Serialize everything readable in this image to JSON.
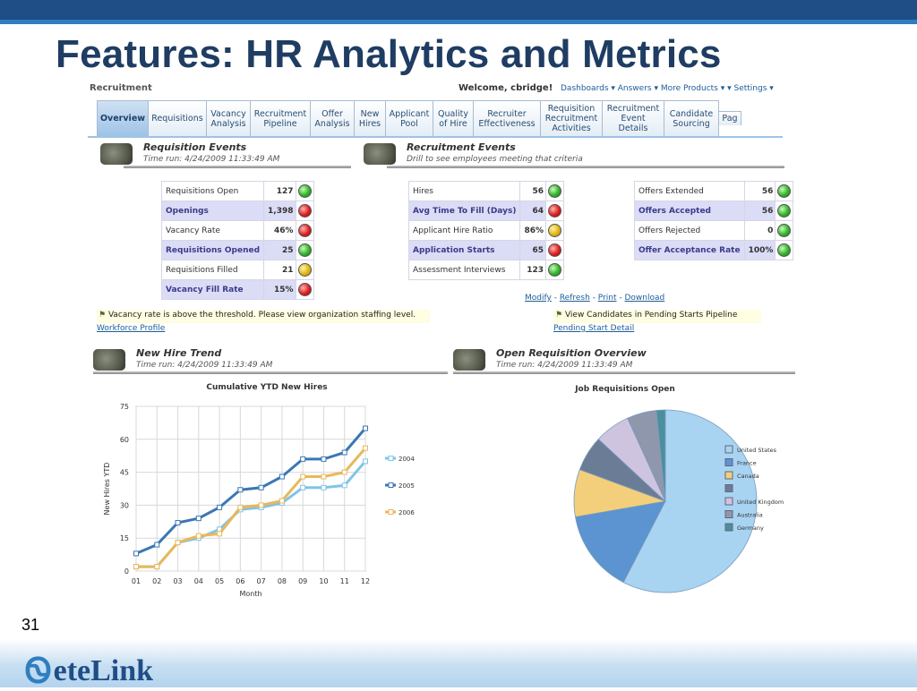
{
  "slide": {
    "title": "Features: HR Analytics and Metrics",
    "number": "31",
    "logo_text": "eteLink"
  },
  "app": {
    "name": "Recruitment",
    "welcome": "Welcome, cbridge!",
    "nav_links": "Dashboards ▾ Answers ▾ More Products ▾ ▾ Settings ▾"
  },
  "tabs": [
    {
      "label": "Overview",
      "active": true
    },
    {
      "label": "Requisitions"
    },
    {
      "label": "Vacancy Analysis"
    },
    {
      "label": "Recruitment Pipeline"
    },
    {
      "label": "Offer Analysis"
    },
    {
      "label": "New Hires"
    },
    {
      "label": "Applicant Pool"
    },
    {
      "label": "Quality of Hire"
    },
    {
      "label": "Recruiter Effectiveness"
    },
    {
      "label": "Requisition Recruitment Activities"
    },
    {
      "label": "Recruitment Event Details"
    },
    {
      "label": "Candidate Sourcing"
    },
    {
      "label": "Pag"
    }
  ],
  "sections": {
    "requisition_events": {
      "title": "Requisition Events",
      "subtitle": "Time run: 4/24/2009 11:33:49 AM"
    },
    "recruitment_events": {
      "title": "Recruitment Events",
      "subtitle": "Drill to see employees meeting that criteria"
    },
    "new_hire_trend": {
      "title": "New Hire Trend",
      "subtitle": "Time run: 4/24/2009 11:33:49 AM"
    },
    "open_requisition": {
      "title": "Open Requisition Overview",
      "subtitle": "Time run: 4/24/2009 11:33:49 AM"
    }
  },
  "requisition_metrics": [
    {
      "label": "Requisitions Open",
      "value": "127",
      "status": "green"
    },
    {
      "label": "Openings",
      "value": "1,398",
      "status": "red"
    },
    {
      "label": "Vacancy Rate",
      "value": "46%",
      "status": "red"
    },
    {
      "label": "Requisitions Opened",
      "value": "25",
      "status": "green"
    },
    {
      "label": "Requisitions Filled",
      "value": "21",
      "status": "yellow"
    },
    {
      "label": "Vacancy Fill Rate",
      "value": "15%",
      "status": "red"
    }
  ],
  "recruitment_metrics": [
    {
      "label": "Hires",
      "value": "56",
      "status": "green"
    },
    {
      "label": "Avg Time To Fill (Days)",
      "value": "64",
      "status": "red"
    },
    {
      "label": "Applicant Hire Ratio",
      "value": "86%",
      "status": "yellow"
    },
    {
      "label": "Application Starts",
      "value": "65",
      "status": "red"
    },
    {
      "label": "Assessment Interviews",
      "value": "123",
      "status": "green"
    }
  ],
  "offer_metrics": [
    {
      "label": "Offers Extended",
      "value": "56",
      "status": "green"
    },
    {
      "label": "Offers Accepted",
      "value": "56",
      "status": "green"
    },
    {
      "label": "Offers Rejected",
      "value": "0",
      "status": "green"
    },
    {
      "label": "Offer Acceptance Rate",
      "value": "100%",
      "status": "green"
    }
  ],
  "actions": {
    "modify": "Modify",
    "refresh": "Refresh",
    "print": "Print",
    "download": "Download"
  },
  "alerts": {
    "vacancy": "Vacancy rate is above the threshold. Please view organization staffing level.",
    "workforce_link": "Workforce Profile",
    "pending": "View Candidates in Pending Starts Pipeline",
    "pending_link": "Pending Start Detail"
  },
  "colors": {
    "green": "#33b12b",
    "red": "#dd1f1f",
    "yellow": "#e2b413"
  },
  "chart_data": [
    {
      "type": "line",
      "title": "Cumulative YTD New Hires",
      "xlabel": "Month",
      "ylabel": "New Hires YTD",
      "categories": [
        "01",
        "02",
        "03",
        "04",
        "05",
        "06",
        "07",
        "08",
        "09",
        "10",
        "11",
        "12"
      ],
      "ylim": [
        0,
        75
      ],
      "yticks": [
        0,
        15,
        30,
        45,
        60,
        75
      ],
      "grid": true,
      "legend": "right",
      "series": [
        {
          "name": "2004",
          "color": "#7fc4e8",
          "values": [
            2,
            2,
            13,
            15,
            19,
            28,
            29,
            31,
            38,
            38,
            39,
            50
          ]
        },
        {
          "name": "2005",
          "color": "#3a77b4",
          "values": [
            8,
            12,
            22,
            24,
            29,
            37,
            38,
            43,
            51,
            51,
            54,
            65
          ]
        },
        {
          "name": "2006",
          "color": "#e8b85a",
          "values": [
            2,
            2,
            13,
            16,
            17,
            29,
            30,
            32,
            43,
            43,
            45,
            56
          ]
        }
      ]
    },
    {
      "type": "pie",
      "title": "Job Requisitions Open",
      "legend": "right",
      "slices": [
        {
          "name": "United States",
          "value": 55,
          "color": "#a8d4f2"
        },
        {
          "name": "France",
          "value": 14,
          "color": "#5b94d0"
        },
        {
          "name": "Canada",
          "value": 8,
          "color": "#f3cf7b"
        },
        {
          "name": "",
          "value": 6,
          "color": "#6b7d96"
        },
        {
          "name": "United Kingdom",
          "value": 6,
          "color": "#cfc4e0"
        },
        {
          "name": "Australia",
          "value": 5,
          "color": "#8e97ab"
        },
        {
          "name": "Germany",
          "value": 1.5,
          "color": "#4c8f9c"
        }
      ]
    }
  ]
}
